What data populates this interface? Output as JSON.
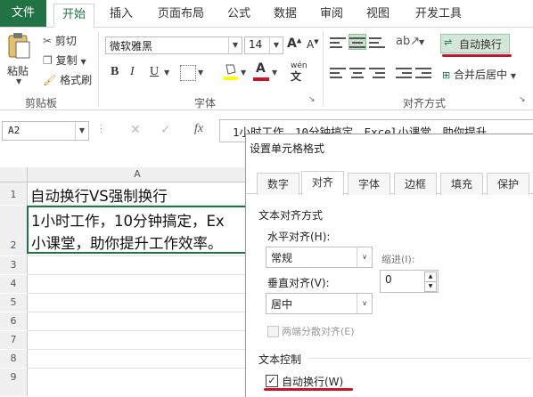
{
  "ribbon_tabs": [
    "文件",
    "开始",
    "插入",
    "页面布局",
    "公式",
    "数据",
    "审阅",
    "视图",
    "开发工具"
  ],
  "clipboard": {
    "paste": "粘贴",
    "cut": "剪切",
    "copy": "复制",
    "format_painter": "格式刷",
    "group_label": "剪贴板"
  },
  "font": {
    "name": "微软雅黑",
    "size": "14",
    "bold": "B",
    "italic": "I",
    "underline": "U",
    "font_color_letter": "A",
    "phonetic": "wén",
    "group_label": "字体"
  },
  "alignment": {
    "wrap_text": "自动换行",
    "merge_center": "合并后居中",
    "group_label": "对齐方式"
  },
  "formula_bar": {
    "name_box": "A2",
    "fx": "fx",
    "content": "1小时工作，10分钟搞定，Excel小课堂，助你提升"
  },
  "sheet": {
    "column_a": "A",
    "rows": [
      "1",
      "2",
      "3",
      "4",
      "5",
      "6",
      "7",
      "8",
      "9"
    ],
    "cell_a1": "自动换行VS强制换行",
    "cell_a2_line1": "1小时工作，10分钟搞定，Ex",
    "cell_a2_line2": "小课堂，助你提升工作效率。"
  },
  "dialog": {
    "title": "设置单元格格式",
    "tabs": [
      "数字",
      "对齐",
      "字体",
      "边框",
      "填充",
      "保护"
    ],
    "active_tab": "对齐",
    "section_text_alignment": "文本对齐方式",
    "horizontal_label": "水平对齐(H):",
    "horizontal_value": "常规",
    "indent_label": "缩进(I):",
    "indent_value": "0",
    "vertical_label": "垂直对齐(V):",
    "vertical_value": "居中",
    "justify_distributed": "两端分散对齐(E)",
    "section_text_control": "文本控制",
    "wrap_text_checkbox": "自动换行(W)",
    "wrap_text_checked": true
  },
  "colors": {
    "excel_green": "#217346",
    "highlight_red": "#c0172b",
    "wrap_button_bg": "#d4e6d9",
    "align_active_bg": "#c6e0c9"
  }
}
